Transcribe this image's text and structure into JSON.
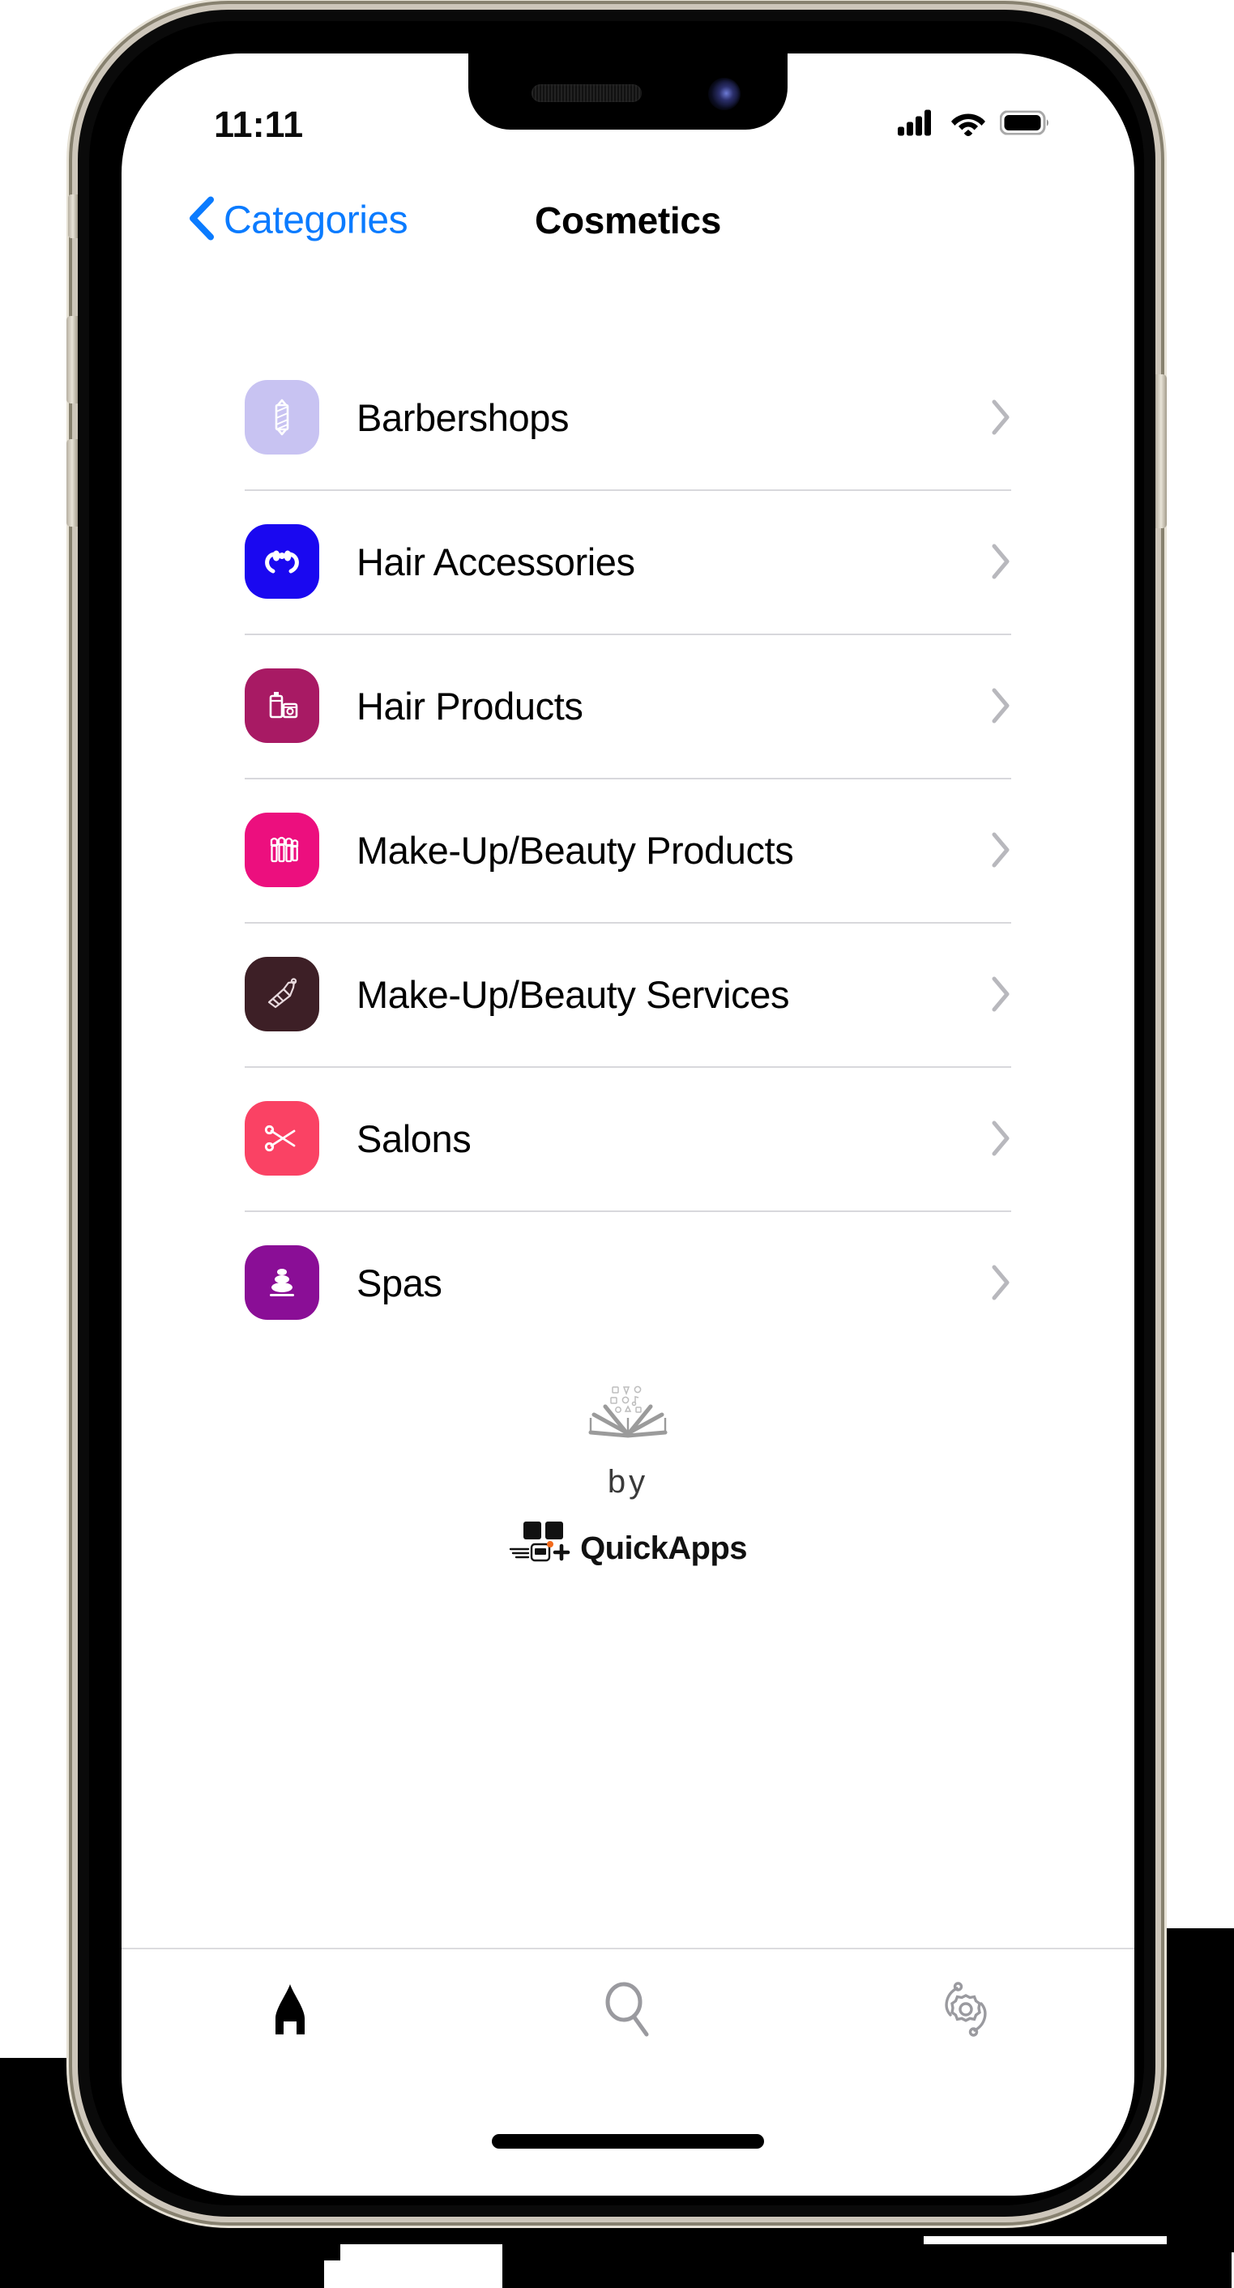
{
  "status_bar": {
    "time": "11:11",
    "signal_icon": "cellular-signal-icon",
    "wifi_icon": "wifi-icon",
    "battery_icon": "battery-full-icon"
  },
  "nav": {
    "back_label": "Categories",
    "back_icon": "chevron-left-icon",
    "title": "Cosmetics"
  },
  "list": {
    "items": [
      {
        "label": "Barbershops",
        "icon": "barber-pole-icon",
        "tile_color": "#c8c3f2",
        "glyph_color": "#ffffff"
      },
      {
        "label": "Hair Accessories",
        "icon": "hair-bow-icon",
        "tile_color": "#1a08f0",
        "glyph_color": "#ffffff"
      },
      {
        "label": "Hair Products",
        "icon": "hair-bottles-icon",
        "tile_color": "#a81a64",
        "glyph_color": "#ffffff"
      },
      {
        "label": "Make-Up/Beauty Products",
        "icon": "makeup-brushes-icon",
        "tile_color": "#ec0f7e",
        "glyph_color": "#ffffff"
      },
      {
        "label": "Make-Up/Beauty Services",
        "icon": "makeup-brush-icon",
        "tile_color": "#3d1f26",
        "glyph_color": "#e8d9dd"
      },
      {
        "label": "Salons",
        "icon": "scissors-icon",
        "tile_color": "#fa4264",
        "glyph_color": "#ffffff"
      },
      {
        "label": "Spas",
        "icon": "spa-stones-icon",
        "tile_color": "#8a0e96",
        "glyph_color": "#ffffff"
      }
    ],
    "chevron_icon": "chevron-right-icon"
  },
  "brand": {
    "book_icon": "open-book-icon",
    "by_text": "by",
    "logo_icon": "quickapps-logo-icon",
    "name": "QuickApps"
  },
  "tabbar": {
    "tabs": [
      {
        "icon": "home-icon",
        "active": true
      },
      {
        "icon": "search-icon",
        "active": false
      },
      {
        "icon": "settings-icon",
        "active": false
      }
    ]
  },
  "colors": {
    "accent_blue": "#0a7bff",
    "separator": "#d8d8dc",
    "inactive_gray": "#9a9a9f"
  }
}
